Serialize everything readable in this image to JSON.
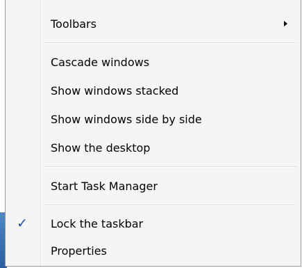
{
  "context_menu": {
    "items": [
      {
        "label": "Toolbars",
        "submenu": true
      },
      {
        "label": "Cascade windows"
      },
      {
        "label": "Show windows stacked"
      },
      {
        "label": "Show windows side by side"
      },
      {
        "label": "Show the desktop"
      },
      {
        "label": "Start Task Manager"
      },
      {
        "label": "Lock the taskbar",
        "checked": true
      },
      {
        "label": "Properties"
      }
    ],
    "submenu_arrow_icon": "chevron-right-icon",
    "check_icon": "checkmark-icon",
    "check_glyph": "✓",
    "colors": {
      "background": "#f5f5f5",
      "border": "#979797",
      "separator": "#e0e0e0",
      "check": "#1a4fa8",
      "text": "#000000"
    }
  }
}
